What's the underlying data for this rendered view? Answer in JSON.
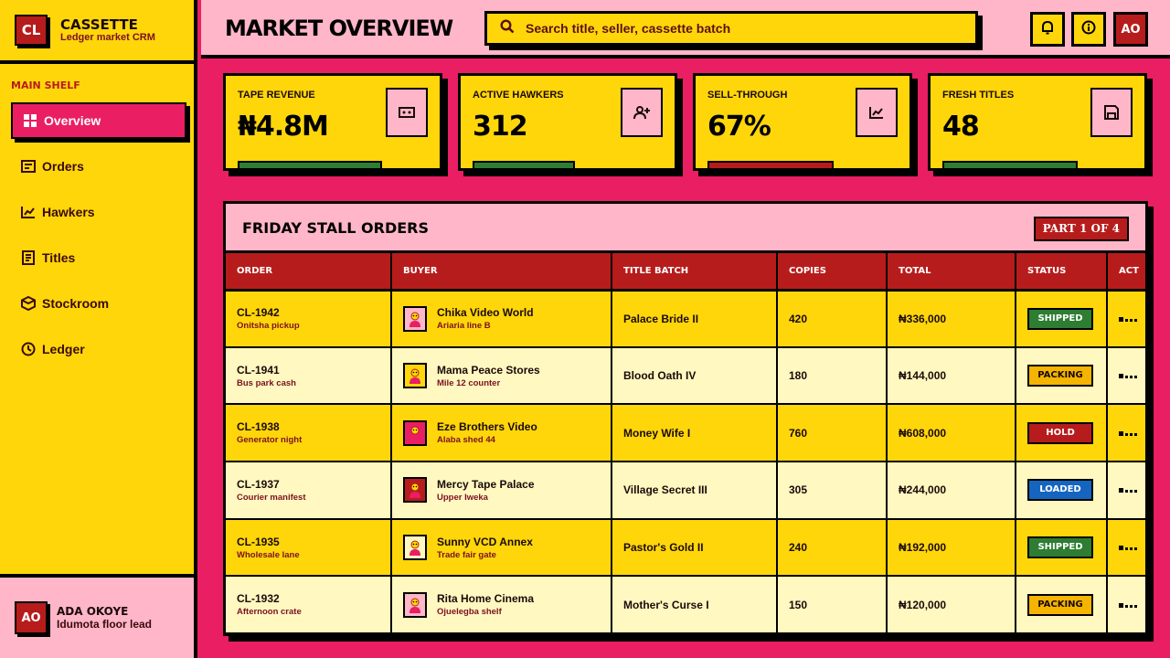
{
  "brand": {
    "logo": "CL",
    "name": "CASSETTE",
    "subtitle": "Ledger market CRM"
  },
  "sidebar": {
    "section": "MAIN SHELF",
    "items": [
      {
        "label": "Overview",
        "icon": "grid-icon",
        "active": true
      },
      {
        "label": "Orders",
        "icon": "orders-icon"
      },
      {
        "label": "Hawkers",
        "icon": "chart-line-icon"
      },
      {
        "label": "Titles",
        "icon": "list-icon"
      },
      {
        "label": "Stockroom",
        "icon": "box-icon"
      },
      {
        "label": "Ledger",
        "icon": "clock-icon"
      }
    ]
  },
  "user": {
    "initials": "AO",
    "name": "ADA OKOYE",
    "role": "Idumota floor lead"
  },
  "header": {
    "title": "MARKET OVERVIEW",
    "search_placeholder": "Search title, seller, cassette batch",
    "avatar": "AO"
  },
  "kpis": [
    {
      "label": "TAPE REVENUE",
      "value": "₦4.8M",
      "icon": "cassette-icon"
    },
    {
      "label": "ACTIVE HAWKERS",
      "value": "312",
      "icon": "user-plus-icon"
    },
    {
      "label": "SELL-THROUGH",
      "value": "67%",
      "icon": "trend-icon"
    },
    {
      "label": "FRESH TITLES",
      "value": "48",
      "icon": "save-icon"
    }
  ],
  "table": {
    "title": "FRIDAY STALL ORDERS",
    "pager": "PART 1 OF 4",
    "columns": [
      "ORDER",
      "BUYER",
      "TITLE BATCH",
      "COPIES",
      "TOTAL",
      "STATUS",
      "ACT"
    ],
    "rows": [
      {
        "id": "CL-1942",
        "note": "Onitsha pickup",
        "buyer": "Chika Video World",
        "buyer_sub": "Ariaria line B",
        "title": "Palace Bride II",
        "copies": "420",
        "total": "₦336,000",
        "status": "SHIPPED",
        "avatar_bg": "#ffb6c8"
      },
      {
        "id": "CL-1941",
        "note": "Bus park cash",
        "buyer": "Mama Peace Stores",
        "buyer_sub": "Mile 12 counter",
        "title": "Blood Oath IV",
        "copies": "180",
        "total": "₦144,000",
        "status": "PACKING",
        "avatar_bg": "#ffd60a"
      },
      {
        "id": "CL-1938",
        "note": "Generator night",
        "buyer": "Eze Brothers Video",
        "buyer_sub": "Alaba shed 44",
        "title": "Money Wife I",
        "copies": "760",
        "total": "₦608,000",
        "status": "HOLD",
        "avatar_bg": "#e91e63"
      },
      {
        "id": "CL-1937",
        "note": "Courier manifest",
        "buyer": "Mercy Tape Palace",
        "buyer_sub": "Upper Iweka",
        "title": "Village Secret III",
        "copies": "305",
        "total": "₦244,000",
        "status": "LOADED",
        "avatar_bg": "#b71c1c"
      },
      {
        "id": "CL-1935",
        "note": "Wholesale lane",
        "buyer": "Sunny VCD Annex",
        "buyer_sub": "Trade fair gate",
        "title": "Pastor's Gold II",
        "copies": "240",
        "total": "₦192,000",
        "status": "SHIPPED",
        "avatar_bg": "#fff8c0"
      },
      {
        "id": "CL-1932",
        "note": "Afternoon crate",
        "buyer": "Rita Home Cinema",
        "buyer_sub": "Ojuelegba shelf",
        "title": "Mother's Curse I",
        "copies": "150",
        "total": "₦120,000",
        "status": "PACKING",
        "avatar_bg": "#ffb6c8"
      }
    ]
  },
  "colors": {
    "primary": "#e91e63",
    "yellow": "#ffd60a",
    "red": "#b71c1c",
    "pink": "#ffb6c8",
    "green": "#2e7d32",
    "blue": "#1565c0"
  }
}
